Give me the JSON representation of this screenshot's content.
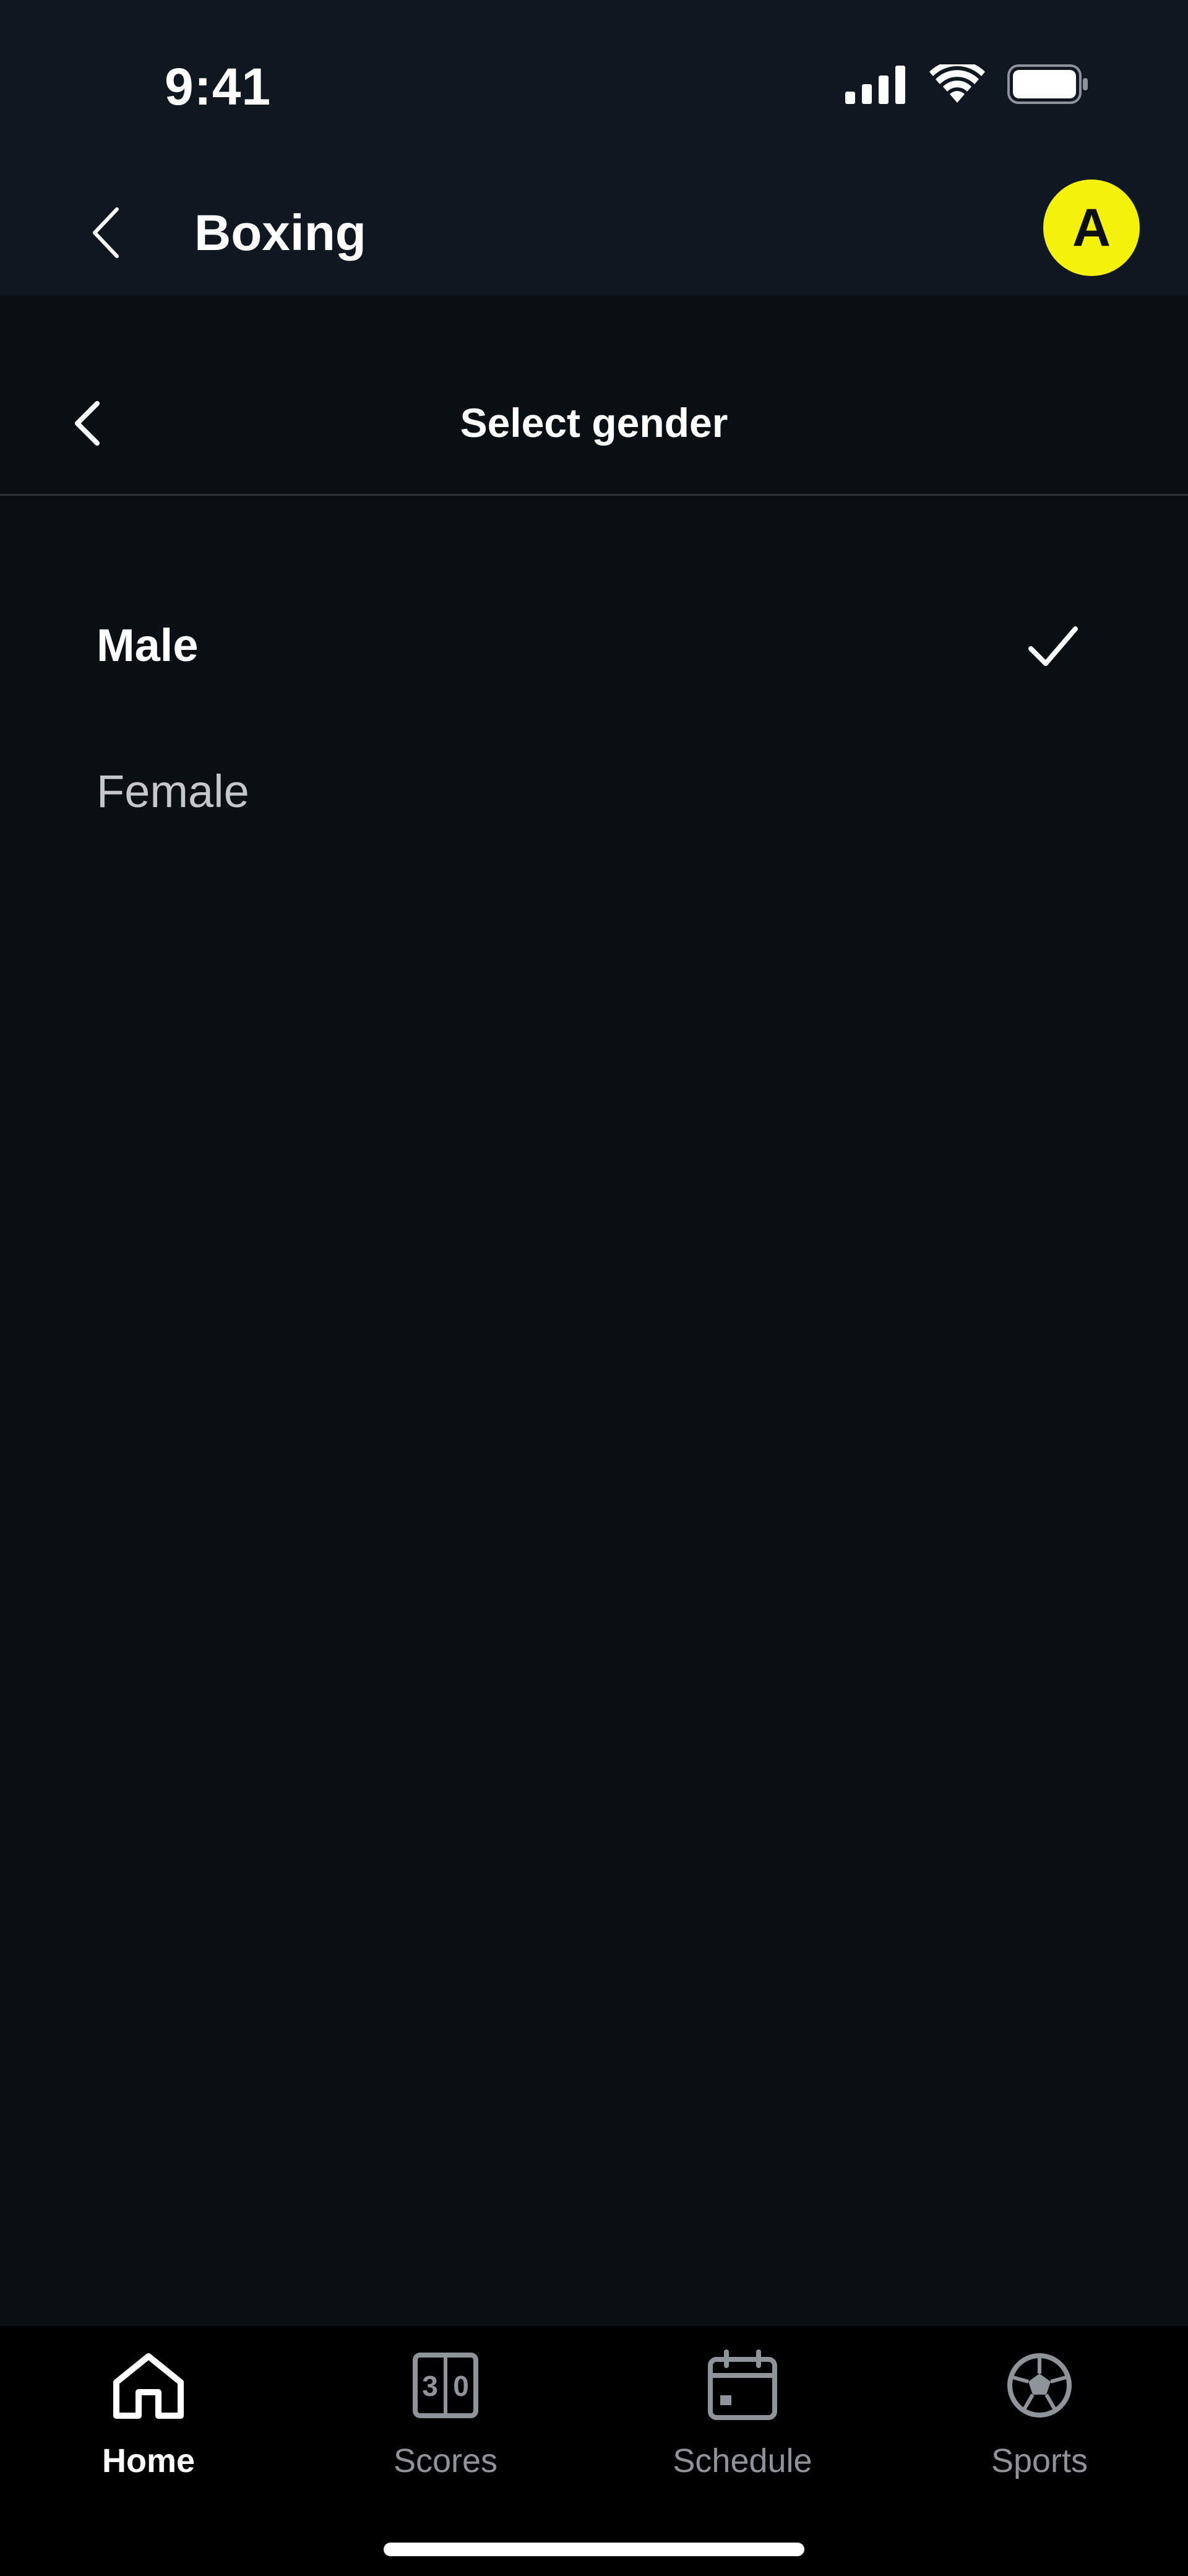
{
  "status_bar": {
    "time": "9:41"
  },
  "header": {
    "title": "Boxing",
    "avatar_letter": "A",
    "avatar_color": "#f4f20a"
  },
  "sub_header": {
    "title": "Select gender"
  },
  "options": [
    {
      "label": "Male",
      "selected": true
    },
    {
      "label": "Female",
      "selected": false
    }
  ],
  "bottom_nav": {
    "items": [
      {
        "label": "Home",
        "icon": "home-icon",
        "active": true
      },
      {
        "label": "Scores",
        "icon": "scoreboard-icon",
        "active": false
      },
      {
        "label": "Schedule",
        "icon": "calendar-icon",
        "active": false
      },
      {
        "label": "Sports",
        "icon": "soccer-ball-icon",
        "active": false
      }
    ]
  },
  "colors": {
    "background": "#0a0f14",
    "header_background": "#0f1720",
    "accent": "#f4f20a",
    "inactive_text": "#8e9499"
  }
}
